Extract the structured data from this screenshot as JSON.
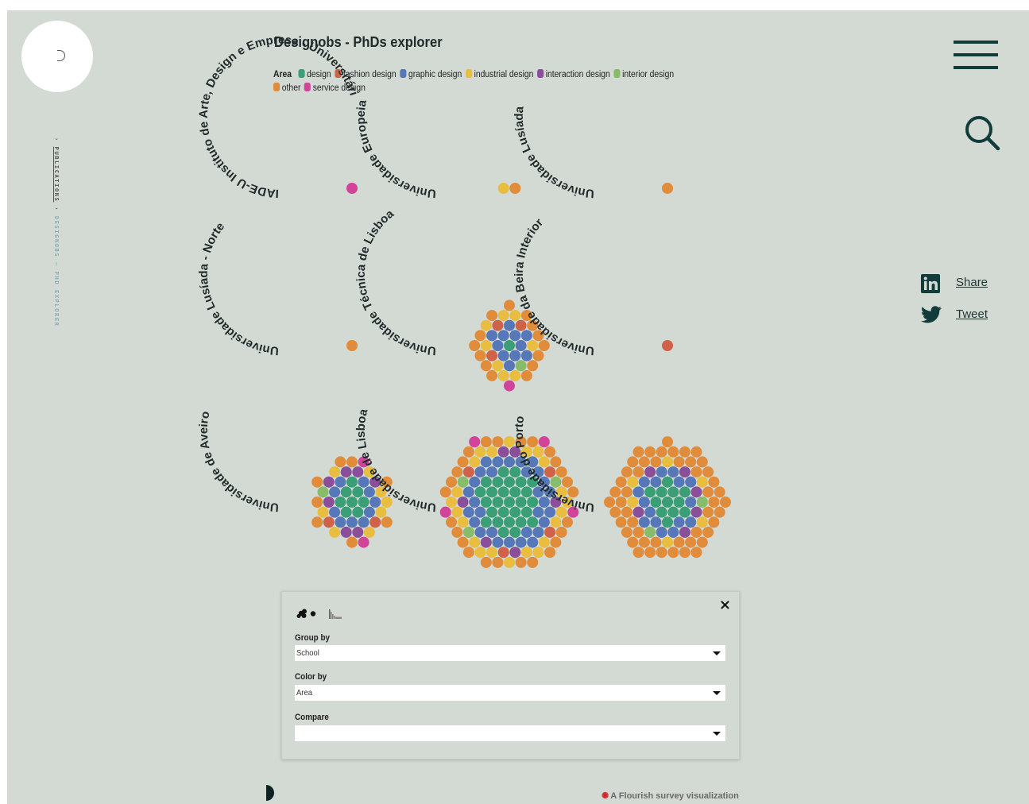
{
  "title": "Designobs - PhDs explorer",
  "breadcrumb": {
    "arrow1": "›",
    "publications": "PUBLICATIONS",
    "arrow2": "›",
    "current": "DESIGNOBS – PHD EXPLORER"
  },
  "legend": {
    "title": "Area",
    "items": [
      {
        "label": "design",
        "color": "#3a9e77"
      },
      {
        "label": "fashion design",
        "color": "#d0624a"
      },
      {
        "label": "graphic design",
        "color": "#5677b8"
      },
      {
        "label": "industrial design",
        "color": "#e9bd3f"
      },
      {
        "label": "interaction design",
        "color": "#8b4f9a"
      },
      {
        "label": "interior design",
        "color": "#88bc6a"
      },
      {
        "label": "other",
        "color": "#e08c3a"
      },
      {
        "label": "service design",
        "color": "#d1449a"
      }
    ]
  },
  "chart_data": {
    "type": "packed-circles",
    "groups": [
      {
        "label": "IADE-U Instituto de Arte, Design e Empresa - Universitári",
        "counts": {
          "service design": 1
        }
      },
      {
        "label": "Universidade Europeia",
        "counts": {
          "industrial design": 1,
          "other": 1
        }
      },
      {
        "label": "Universidade Lusíada",
        "counts": {
          "other": 1
        }
      },
      {
        "label": "Universidade Lusíada - Norte",
        "counts": {
          "other": 1
        }
      },
      {
        "label": "Universidade Técnica de Lisboa",
        "counts": {
          "other": 14,
          "industrial design": 8,
          "graphic design": 11,
          "fashion design": 3,
          "design": 1,
          "interior design": 1,
          "service design": 1
        }
      },
      {
        "label": "Universidade da Beira Interior",
        "counts": {
          "fashion design": 1
        }
      },
      {
        "label": "Universidade de Aveiro",
        "counts": {
          "service design": 2,
          "other": 8,
          "industrial design": 8,
          "graphic design": 10,
          "design": 8,
          "interaction design": 7,
          "fashion design": 2,
          "interior design": 1
        }
      },
      {
        "label": "Universidade de Lisboa",
        "counts": {
          "service design": 4,
          "other": 26,
          "industrial design": 22,
          "graphic design": 30,
          "design": 28,
          "interaction design": 6,
          "fashion design": 4,
          "interior design": 3
        }
      },
      {
        "label": "Universidade do Porto",
        "counts": {
          "other": 50,
          "industrial design": 6,
          "graphic design": 16,
          "design": 12,
          "interaction design": 6,
          "interior design": 2
        }
      }
    ]
  },
  "share": {
    "linkedin_label": "Share",
    "twitter_label": "Tweet"
  },
  "controls": {
    "close_label": "×",
    "group_by": {
      "label": "Group by",
      "value": "School"
    },
    "color_by": {
      "label": "Color by",
      "value": "Area"
    },
    "compare": {
      "label": "Compare",
      "value": ""
    }
  },
  "credit": "A Flourish survey visualization"
}
